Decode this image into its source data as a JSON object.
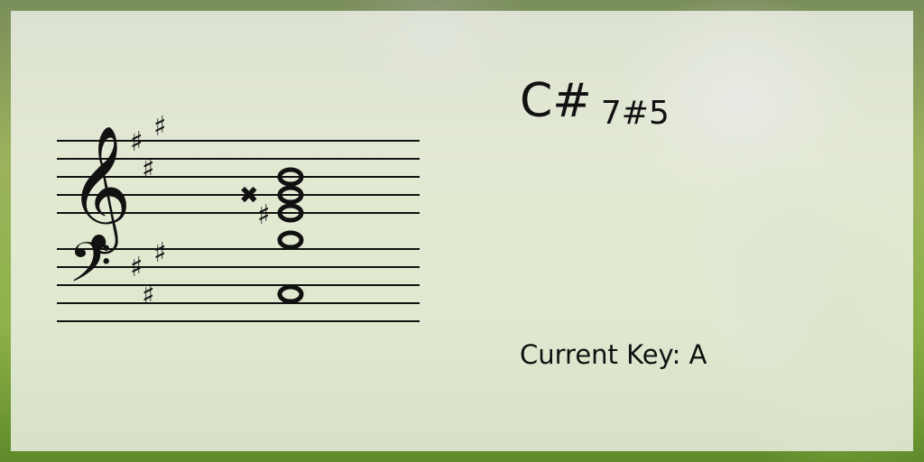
{
  "chord": {
    "root": "C#",
    "quality": "7#5"
  },
  "key": {
    "label": "Current Key:",
    "value": "A"
  },
  "staff": {
    "treble_key_signature": [
      "sharp",
      "sharp",
      "sharp"
    ],
    "bass_key_signature": [
      "sharp",
      "sharp",
      "sharp"
    ],
    "chord_noteheads": 5,
    "accidentals": [
      "double-sharp",
      "sharp"
    ]
  }
}
